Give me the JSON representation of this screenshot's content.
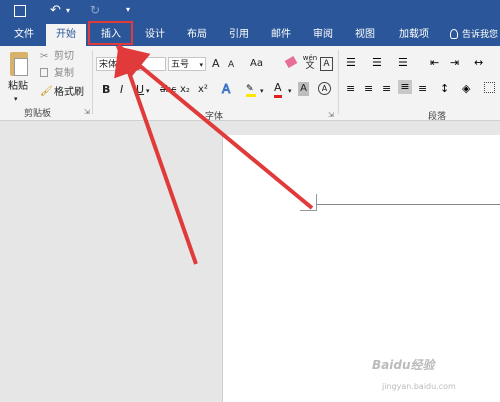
{
  "tabs": [
    "文件",
    "开始",
    "插入",
    "设计",
    "布局",
    "引用",
    "邮件",
    "审阅",
    "视图",
    "加载项"
  ],
  "tell_me": "告诉我您",
  "clipboard": {
    "paste": "粘贴",
    "cut": "剪切",
    "copy": "复制",
    "format_painter": "格式刷",
    "group_label": "剪贴板"
  },
  "font": {
    "font_name": "宋体",
    "font_size": "五号",
    "group_label": "字体",
    "grow": "A",
    "shrink": "A",
    "case": "Aa",
    "phonetic_top": "wén",
    "phonetic_bottom": "文",
    "bold": "B",
    "italic": "I",
    "underline": "U",
    "strike": "abc",
    "subscript": "x₂",
    "superscript": "x²",
    "font_color_a": "A",
    "highlight_a": "A",
    "char_shade": "A",
    "clear_format": "A"
  },
  "paragraph": {
    "group_label": "段落"
  },
  "watermark": {
    "line1": "Baidu经验",
    "line2": "jingyan.baidu.com"
  },
  "colors": {
    "ribbon_blue": "#2b579a",
    "highlight_red": "#e03a3a"
  }
}
